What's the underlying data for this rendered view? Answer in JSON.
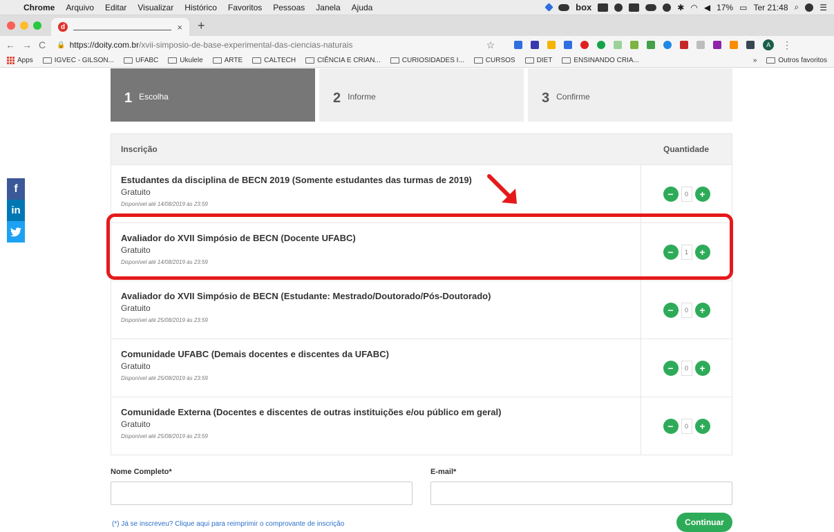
{
  "menubar": {
    "app": "Chrome",
    "items": [
      "Arquivo",
      "Editar",
      "Visualizar",
      "Histórico",
      "Favoritos",
      "Pessoas",
      "Janela",
      "Ajuda"
    ],
    "box_label": "box",
    "battery": "17%",
    "clock": "Ter 21:48"
  },
  "tab": {
    "favicon_letter": "d",
    "close": "×",
    "new_tab": "+"
  },
  "toolbar": {
    "url_host": "https://doity.com.br",
    "url_path": "/xvii-simposio-de-base-experimental-das-ciencias-naturais",
    "avatar_letter": "A"
  },
  "bookmarks": {
    "apps": "Apps",
    "items": [
      "IGVEC - GILSON...",
      "UFABC",
      "Ukulele",
      "ARTE",
      "CALTECH",
      "CIÊNCIA E CRIAN...",
      "CURIOSIDADES I...",
      "CURSOS",
      "DIET",
      "ENSINANDO CRIA..."
    ],
    "overflow": "»",
    "other": "Outros favoritos"
  },
  "steps": [
    {
      "num": "1",
      "label": "Escolha"
    },
    {
      "num": "2",
      "label": "Informe"
    },
    {
      "num": "3",
      "label": "Confirme"
    }
  ],
  "social": {
    "facebook": "f",
    "linkedin": "in",
    "twitter": "🐦"
  },
  "table": {
    "header_inscricao": "Inscrição",
    "header_quantidade": "Quantidade",
    "rows": [
      {
        "name": "Estudantes da disciplina de BECN 2019 (Somente estudantes das turmas de 2019)",
        "price": "Gratuito",
        "available": "Disponível até 14/08/2019 às 23:59",
        "qty": "0"
      },
      {
        "name": "Avaliador do XVII Simpósio de BECN (Docente UFABC)",
        "price": "Gratuito",
        "available": "Disponível até 14/08/2019 às 23:59",
        "qty": "1"
      },
      {
        "name": "Avaliador do XVII Simpósio de BECN (Estudante: Mestrado/Doutorado/Pós-Doutorado)",
        "price": "Gratuito",
        "available": "Disponível até 25/08/2019 às 23:59",
        "qty": "0"
      },
      {
        "name": "Comunidade UFABC (Demais docentes e discentes da UFABC)",
        "price": "Gratuito",
        "available": "Disponível até 25/08/2019 às 23:59",
        "qty": "0"
      },
      {
        "name": "Comunidade Externa (Docentes e discentes de outras instituições e/ou público em geral)",
        "price": "Gratuito",
        "available": "Disponível até 25/08/2019 às 23:59",
        "qty": "0"
      }
    ],
    "minus": "−",
    "plus": "+"
  },
  "form": {
    "name_label": "Nome Completo*",
    "email_label": "E-mail*",
    "name_value": "",
    "email_value": "",
    "reprint_link": "(*) Já se inscreveu? Clique aqui para reimprimir o comprovante de inscrição",
    "continue": "Continuar"
  },
  "colors": {
    "accent_green": "#2eab59",
    "highlight_red": "#e5191b",
    "link_blue": "#2b70c9"
  }
}
